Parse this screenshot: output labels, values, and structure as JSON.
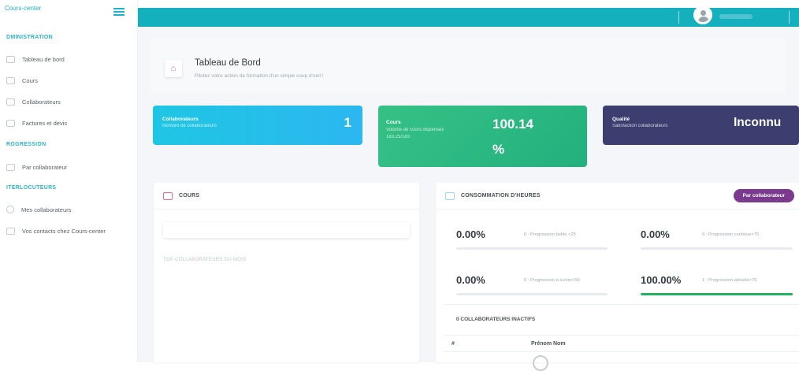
{
  "sidebar": {
    "brand": "Cours-center",
    "sections": [
      {
        "label": "DMINISTRATION"
      },
      {
        "label": "ROGRESSION"
      },
      {
        "label": "ITERLOCUTEURS"
      }
    ],
    "items": [
      {
        "label": "Tableau de bord"
      },
      {
        "label": "Cours"
      },
      {
        "label": "Collaborateurs"
      },
      {
        "label": "Factures et devis"
      },
      {
        "label": "Par collaborateur"
      },
      {
        "label": "Mes collaborateurs"
      },
      {
        "label": "Vos contacts chez Cours-center"
      }
    ]
  },
  "page": {
    "title": "Tableau de Bord",
    "subtitle": "Pilotez votre action de formation d'un simple coup d'oeil !"
  },
  "stats": [
    {
      "title": "Collaborateurs",
      "subtitle": "Nombre de collaborateurs",
      "value": "1",
      "color": "#25c0e8"
    },
    {
      "title": "Cours",
      "subtitle": "Volume de cours dispensés",
      "subtitle2": "183.25/183",
      "value": "100.14",
      "value2": "%",
      "color": "#2fbb82"
    },
    {
      "title": "Qualité",
      "subtitle": "Satisfaction collaborateurs",
      "value": "Inconnu",
      "color": "#3b3e6e"
    }
  ],
  "cours_card": {
    "title": "COURS",
    "top_label": "TOP COLLABORATEURS DU MOIS"
  },
  "conso_card": {
    "title": "CONSOMMATION D'HEURES",
    "button": "Par collaborateur",
    "kpis": [
      {
        "value": "0.00%",
        "label": "0 : Progression faible <25",
        "progress": 0
      },
      {
        "value": "0.00%",
        "label": "0 : Progression continue<75",
        "progress": 0
      },
      {
        "value": "0.00%",
        "label": "0 : Progression à suivre<50",
        "progress": 0
      },
      {
        "value": "100.00%",
        "label": "1 : Progression aboutie>75",
        "progress": 1.0
      }
    ],
    "inactive_title": "0 COLLABORATEURS INACTIFS",
    "table_headers": [
      "#",
      "Prénom Nom"
    ]
  },
  "colors": {
    "topbar": "#15b0be",
    "sidebar_section": "#2db4c9",
    "pill": "#7a3a8e",
    "progress_fill": "#21b35f"
  }
}
